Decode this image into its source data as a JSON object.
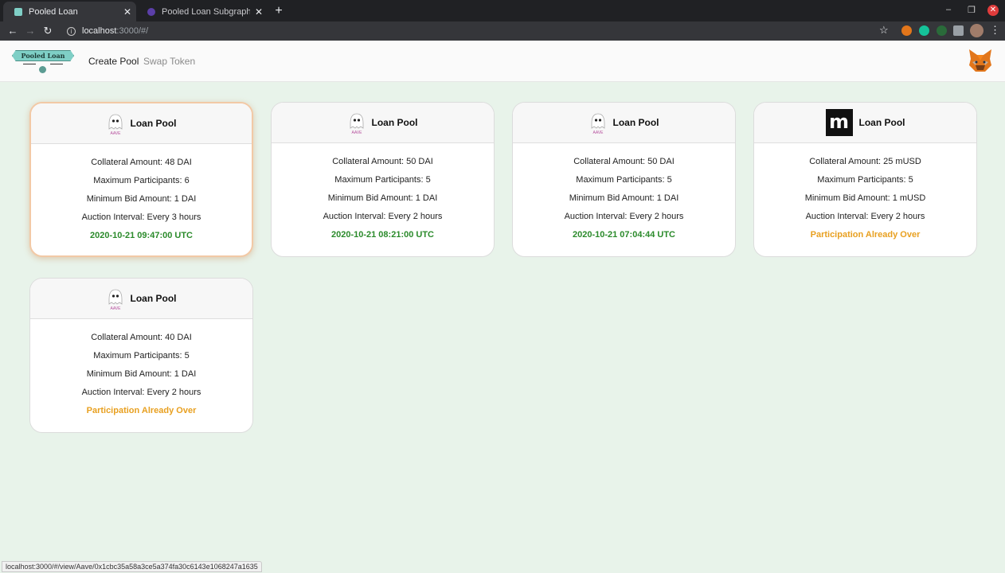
{
  "browser": {
    "tabs": [
      {
        "title": "Pooled Loan",
        "active": true
      },
      {
        "title": "Pooled Loan Subgraph",
        "active": false
      }
    ],
    "close_glyph": "✕",
    "new_tab_glyph": "+",
    "url_host": "localhost",
    "url_rest": ":3000/#/",
    "status_url": "localhost:3000/#/view/Aave/0x1cbc35a58a3ce5a374fa30c6143e1068247a1635",
    "colors": {
      "tabbar": "#202124",
      "toolbar": "#35363a"
    }
  },
  "app": {
    "brand_text": "Pooled Loan",
    "nav": {
      "create_pool": "Create Pool",
      "swap_token": "Swap Token"
    },
    "colors": {
      "background": "#e8f3ea",
      "status_green": "#2a8a2a",
      "status_orange": "#e8a020"
    }
  },
  "cards": [
    {
      "title": "Loan Pool",
      "icon": "aave-ghost-icon",
      "collateral": "Collateral Amount: 48 DAI",
      "participants": "Maximum Participants: 6",
      "min_bid": "Minimum Bid Amount: 1 DAI",
      "interval": "Auction Interval: Every 3 hours",
      "status": "2020-10-21 09:47:00 UTC",
      "status_type": "date"
    },
    {
      "title": "Loan Pool",
      "icon": "aave-ghost-icon",
      "collateral": "Collateral Amount: 50 DAI",
      "participants": "Maximum Participants: 5",
      "min_bid": "Minimum Bid Amount: 1 DAI",
      "interval": "Auction Interval: Every 2 hours",
      "status": "2020-10-21 08:21:00 UTC",
      "status_type": "date"
    },
    {
      "title": "Loan Pool",
      "icon": "aave-ghost-icon",
      "collateral": "Collateral Amount: 50 DAI",
      "participants": "Maximum Participants: 5",
      "min_bid": "Minimum Bid Amount: 1 DAI",
      "interval": "Auction Interval: Every 2 hours",
      "status": "2020-10-21 07:04:44 UTC",
      "status_type": "date"
    },
    {
      "title": "Loan Pool",
      "icon": "mstable-icon",
      "collateral": "Collateral Amount: 25 mUSD",
      "participants": "Maximum Participants: 5",
      "min_bid": "Minimum Bid Amount: 1 mUSD",
      "interval": "Auction Interval: Every 2 hours",
      "status": "Participation Already Over",
      "status_type": "over"
    },
    {
      "title": "Loan Pool",
      "icon": "aave-ghost-icon",
      "collateral": "Collateral Amount: 40 DAI",
      "participants": "Maximum Participants: 5",
      "min_bid": "Minimum Bid Amount: 1 DAI",
      "interval": "Auction Interval: Every 2 hours",
      "status": "Participation Already Over",
      "status_type": "over"
    }
  ]
}
